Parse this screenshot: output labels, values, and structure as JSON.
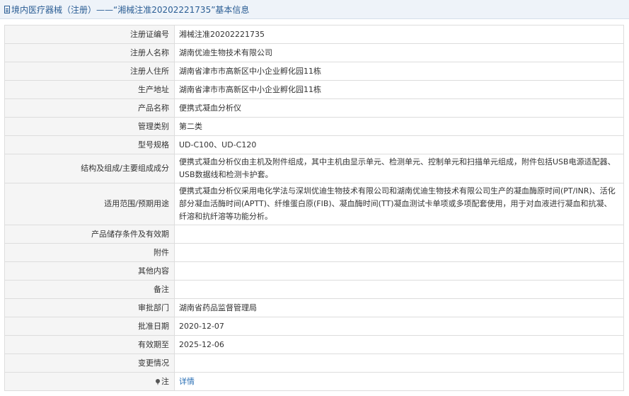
{
  "header": {
    "title": "境内医疗器械（注册）——“湘械注准20202221735”基本信息"
  },
  "rows": [
    {
      "label": "注册证编号",
      "value": "湘械注准20202221735"
    },
    {
      "label": "注册人名称",
      "value": "湖南优迪生物技术有限公司"
    },
    {
      "label": "注册人住所",
      "value": "湖南省津市市高新区中小企业孵化园11栋"
    },
    {
      "label": "生产地址",
      "value": "湖南省津市市高新区中小企业孵化园11栋"
    },
    {
      "label": "产品名称",
      "value": "便携式凝血分析仪"
    },
    {
      "label": "管理类别",
      "value": "第二类"
    },
    {
      "label": "型号规格",
      "value": "UD-C100、UD-C120"
    },
    {
      "label": "结构及组成/主要组成成分",
      "value": "便携式凝血分析仪由主机及附件组成，其中主机由显示单元、检测单元、控制单元和扫描单元组成，附件包括USB电源适配器、USB数据线和检测卡护套。"
    },
    {
      "label": "适用范围/预期用途",
      "value": "便携式凝血分析仪采用电化学法与深圳优迪生物技术有限公司和湖南优迪生物技术有限公司生产的凝血酶原时间(PT/INR)、活化部分凝血活酶时间(APTT)、纤维蛋白原(FIB)、凝血酶时间(TT)凝血测试卡单项或多项配套使用，用于对血液进行凝血和抗凝、纤溶和抗纤溶等功能分析。"
    },
    {
      "label": "产品储存条件及有效期",
      "value": ""
    },
    {
      "label": "附件",
      "value": ""
    },
    {
      "label": "其他内容",
      "value": ""
    },
    {
      "label": "备注",
      "value": ""
    },
    {
      "label": "审批部门",
      "value": "湖南省药品监督管理局"
    },
    {
      "label": "批准日期",
      "value": "2020-12-07"
    },
    {
      "label": "有效期至",
      "value": "2025-12-06"
    },
    {
      "label": "变更情况",
      "value": ""
    },
    {
      "label": "注",
      "value": "详情"
    }
  ],
  "colors": {
    "header_bg": "#eef3f9",
    "header_text": "#2a5d94",
    "label_bg": "#f5f5f5",
    "border": "#dddddd",
    "link": "#2a6fb5"
  },
  "icons": {
    "header": "document-icon",
    "note": "pin-icon"
  }
}
